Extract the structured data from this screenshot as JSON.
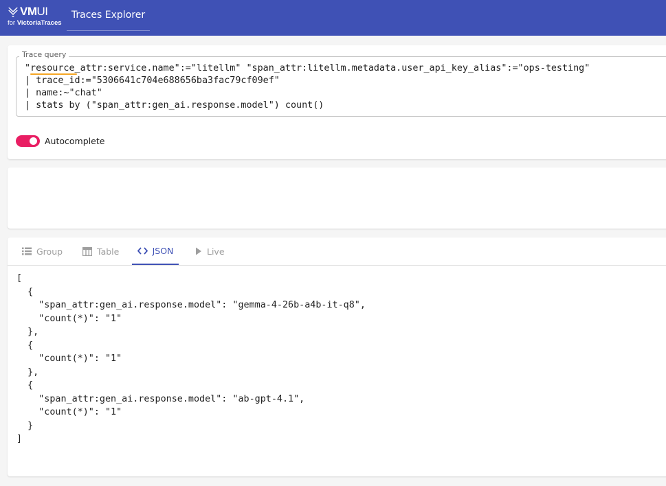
{
  "header": {
    "brand_vm": "VM",
    "brand_ui": "UI",
    "brand_sub_prefix": "for ",
    "brand_sub_name": "VictoriaTraces",
    "nav_tab": "Traces Explorer",
    "color": "#3f51b5"
  },
  "query": {
    "label": "Trace query",
    "text": "\"resource_attr:service.name\":=\"litellm\" \"span_attr:litellm.metadata.user_api_key_alias\":=\"ops-testing\"\n| trace_id:=\"5306641c704e688656ba3fac79cf09ef\"\n| name:~\"chat\"\n| stats by (\"span_attr:gen_ai.response.model\") count()"
  },
  "autocomplete": {
    "label": "Autocomplete",
    "enabled": true,
    "color": "#e91e63"
  },
  "results": {
    "tabs": [
      {
        "label": "Group",
        "icon": "list-icon"
      },
      {
        "label": "Table",
        "icon": "table-icon"
      },
      {
        "label": "JSON",
        "icon": "code-icon",
        "active": true
      },
      {
        "label": "Live",
        "icon": "play-icon"
      }
    ],
    "json_lines": [
      "[",
      "  {",
      "    \"span_attr:gen_ai.response.model\": \"gemma-4-26b-a4b-it-q8\",",
      "    \"count(*)\": \"1\"",
      "  },",
      "  {",
      "    \"count(*)\": \"1\"",
      "  },",
      "  {",
      "    \"span_attr:gen_ai.response.model\": \"ab-gpt-4.1\",",
      "    \"count(*)\": \"1\"",
      "  }",
      "]"
    ]
  }
}
